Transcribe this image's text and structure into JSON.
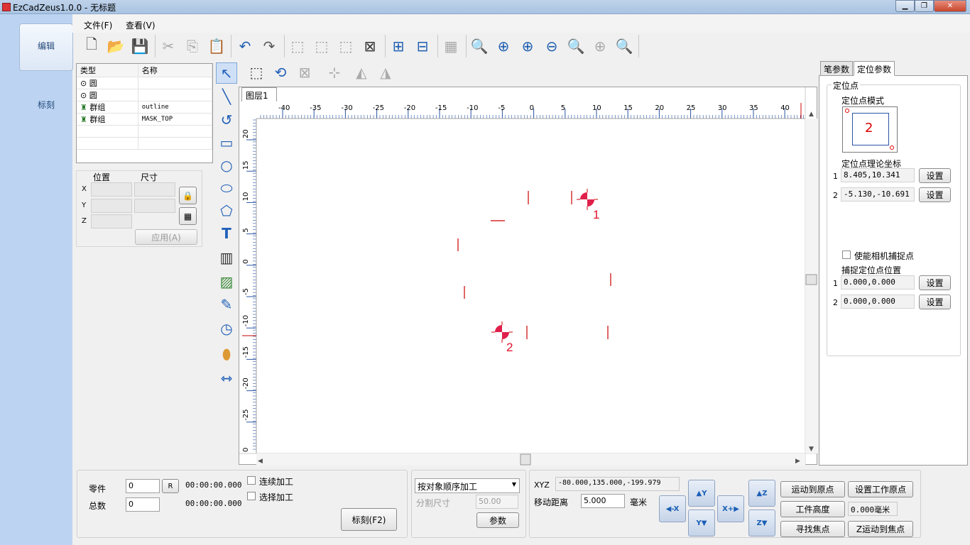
{
  "window": {
    "title": "EzCadZeus1.0.0 - 无标题",
    "min": "▁",
    "max": "❐",
    "close": "✕"
  },
  "nav": {
    "edit": "编辑",
    "mark": "标刻"
  },
  "menu": {
    "file": "文件(F)",
    "view": "查看(V)"
  },
  "objects": {
    "col_type": "类型",
    "col_name": "名称",
    "rows": [
      {
        "type": "圆",
        "name": "",
        "icon": "circle-icon"
      },
      {
        "type": "圆",
        "name": "",
        "icon": "circle-icon"
      },
      {
        "type": "群组",
        "name": "outline",
        "icon": "group-icon"
      },
      {
        "type": "群组",
        "name": "MASK_TOP",
        "icon": "group-icon"
      }
    ]
  },
  "position": {
    "pos": "位置",
    "size": "尺寸",
    "x": "X",
    "y": "Y",
    "z": "Z",
    "apply": "应用(A)"
  },
  "canvas": {
    "layer_tab": "图层1",
    "hticks": [
      "-40",
      "-35",
      "-30",
      "-25",
      "-20",
      "-15",
      "-10",
      "-5",
      "0",
      "5",
      "10",
      "15",
      "20",
      "25",
      "30",
      "35",
      "40"
    ],
    "vticks": [
      "20",
      "15",
      "10",
      "5",
      "0",
      "-5",
      "-10",
      "-15",
      "-20",
      "-25",
      "0"
    ],
    "mark1": "1",
    "mark2": "2"
  },
  "right": {
    "tab_pen": "笔参数",
    "tab_locate": "定位参数",
    "section": "定位点",
    "mode": "定位点模式",
    "mode_value": "2",
    "theory": "定位点理论坐标",
    "theory_rows": [
      {
        "idx": "1",
        "value": "8.405,10.341",
        "btn": "设置"
      },
      {
        "idx": "2",
        "value": "-5.130,-10.691",
        "btn": "设置"
      }
    ],
    "camera": "使能相机捕捉点",
    "capture": "捕捉定位点位置",
    "capture_rows": [
      {
        "idx": "1",
        "value": "0.000,0.000",
        "btn": "设置"
      },
      {
        "idx": "2",
        "value": "0.000,0.000",
        "btn": "设置"
      }
    ]
  },
  "bottom": {
    "part": "零件",
    "total": "总数",
    "part_val": "0",
    "total_val": "0",
    "r": "R",
    "time1": "00:00:00.000",
    "time2": "00:00:00.000",
    "continuous": "连续加工",
    "select": "选择加工",
    "mark_btn": "标刻(F2)",
    "order": "按对象顺序加工",
    "split": "分割尺寸",
    "split_val": "50.00",
    "params": "参数",
    "xyz_label": "XYZ",
    "xyz_val": "-80.000,135.000,-199.979",
    "move_label": "移动距离",
    "move_val": "5.000",
    "unit": "毫米",
    "btn_origin": "运动到原点",
    "btn_set_origin": "设置工作原点",
    "btn_height": "工件高度",
    "height_val": "0.000毫米",
    "btn_find_focus": "寻找焦点",
    "btn_z_focus": "Z运动到焦点",
    "ax_xm": "-X",
    "ax_xp": "X+",
    "ax_yp": "Y",
    "ax_ym": "Y",
    "ax_zp": "Z",
    "ax_zm": "Z"
  }
}
